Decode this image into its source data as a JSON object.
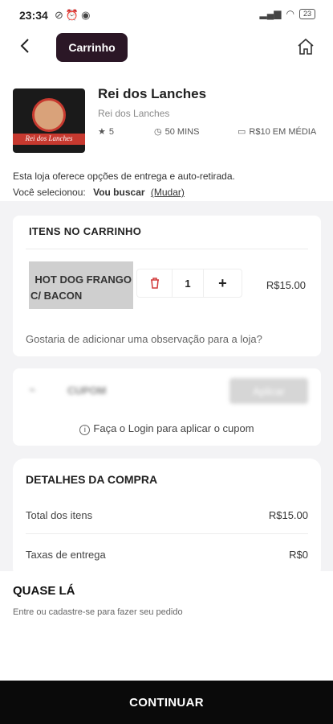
{
  "status_bar": {
    "time": "23:34",
    "battery": "23"
  },
  "header": {
    "title": "Carrinho"
  },
  "store": {
    "name": "Rei dos Lanches",
    "subtitle": "Rei dos Lanches",
    "logo_text": "Rei dos Lanches",
    "rating": "5",
    "delivery_time": "50 MINS",
    "avg_price": "R$10 EM MÉDIA",
    "delivery_info": "Esta loja oferece opções de entrega e auto-retirada.",
    "selected_label": "Você selecionou:",
    "selected_value": "Vou buscar",
    "change_label": "(Mudar)"
  },
  "cart": {
    "title": "ITENS NO CARRINHO",
    "items": [
      {
        "name_line1": "HOT DOG FRANGO",
        "name_line2": "C/ BACON",
        "quantity": "1",
        "price": "R$15.00"
      }
    ],
    "note_placeholder": "Gostaria de adicionar uma observação para a loja?"
  },
  "coupon": {
    "placeholder": "CUPOM",
    "apply_label": "Aplicar",
    "login_hint": "Faça o Login para aplicar o cupom"
  },
  "details": {
    "title": "DETALHES DA COMPRA",
    "rows": [
      {
        "label": "Total dos itens",
        "value": "R$15.00"
      },
      {
        "label": "Taxas de entrega",
        "value": "R$0"
      }
    ]
  },
  "footer": {
    "title": "QUASE LÁ",
    "subtitle": "Entre ou cadastre-se para fazer seu pedido",
    "continue_label": "CONTINUAR"
  }
}
